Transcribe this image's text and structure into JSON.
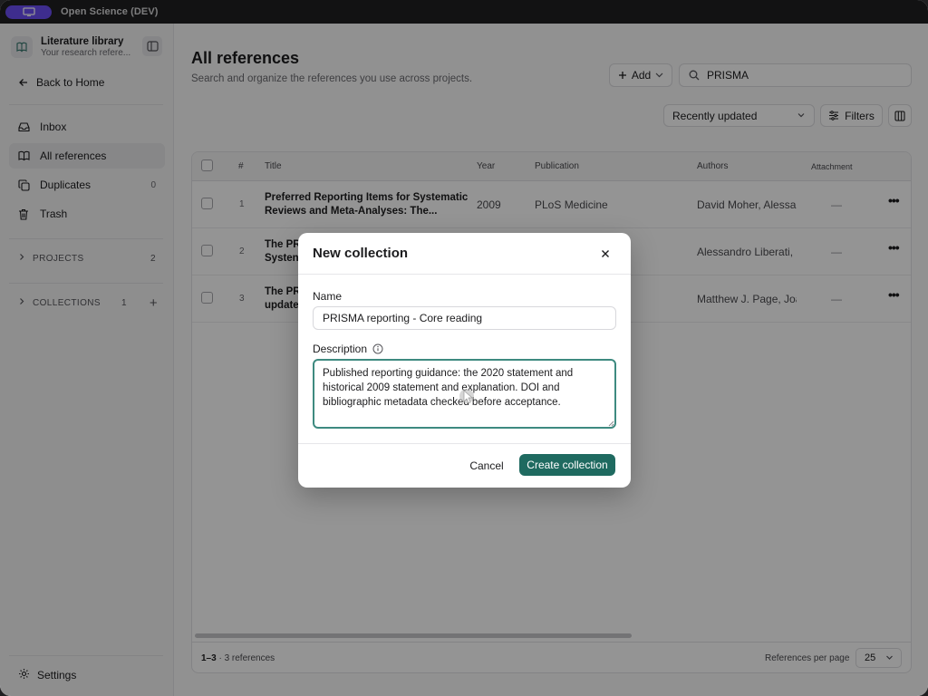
{
  "app": {
    "title": "Open Science (DEV)"
  },
  "sidebar": {
    "library_title": "Literature library",
    "library_subtitle": "Your research refere...",
    "back_label": "Back to Home",
    "nav": [
      {
        "label": "Inbox",
        "count": ""
      },
      {
        "label": "All references",
        "count": ""
      },
      {
        "label": "Duplicates",
        "count": "0"
      },
      {
        "label": "Trash",
        "count": ""
      }
    ],
    "projects": {
      "label": "PROJECTS",
      "count": "2"
    },
    "collections": {
      "label": "COLLECTIONS",
      "count": "1",
      "add_glyph": "+"
    },
    "settings_label": "Settings"
  },
  "main": {
    "title": "All references",
    "subtitle": "Search and organize the references you use across projects.",
    "add_label": "Add",
    "search_value": "PRISMA",
    "sort_value": "Recently updated",
    "filters_label": "Filters"
  },
  "table": {
    "headers": {
      "num": "#",
      "title": "Title",
      "year": "Year",
      "publication": "Publication",
      "authors": "Authors",
      "attachment": "Attachment"
    },
    "rows": [
      {
        "num": "1",
        "title": "Preferred Reporting Items for Systematic Reviews and Meta-Analyses: The...",
        "year": "2009",
        "publication": "PLoS Medicine",
        "authors": "David Moher, Alessan",
        "attachment": "—"
      },
      {
        "num": "2",
        "title": "The PR Systen",
        "year": "",
        "publication": "",
        "authors": "Alessandro Liberati, D",
        "attachment": "—"
      },
      {
        "num": "3",
        "title": "The PR update",
        "year": "",
        "publication": "",
        "authors": "Matthew J. Page, Joa",
        "attachment": "—"
      }
    ],
    "footer": {
      "range": "1–3",
      "count_text": " · 3 references",
      "per_page_label": "References per page",
      "per_page_value": "25"
    }
  },
  "modal": {
    "title": "New collection",
    "name_label": "Name",
    "name_value": "PRISMA reporting - Core reading",
    "description_label": "Description",
    "description_value": "Published reporting guidance: the 2020 statement and historical 2009 statement and explanation. DOI and bibliographic metadata checked before acceptance.",
    "cancel_label": "Cancel",
    "create_label": "Create collection"
  }
}
